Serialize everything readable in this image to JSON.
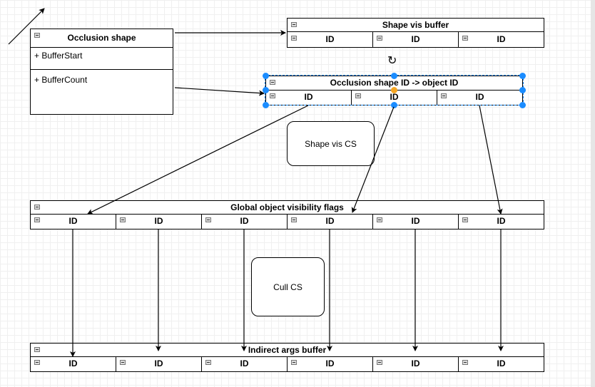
{
  "class_box": {
    "title": "Occlusion shape",
    "attributes": [
      "+ BufferStart",
      "+ BufferCount"
    ]
  },
  "shape_vis_buffer": {
    "title": "Shape vis buffer",
    "cells": [
      "ID",
      "ID",
      "ID"
    ]
  },
  "occlusion_map": {
    "title": "Occlusion shape ID -> object ID",
    "cells": [
      "ID",
      "ID",
      "ID"
    ],
    "selected": true
  },
  "shape_vis_cs": {
    "label": "Shape vis CS"
  },
  "global_flags": {
    "title": "Global object visibility flags",
    "cells": [
      "ID",
      "ID",
      "ID",
      "ID",
      "ID",
      "ID"
    ]
  },
  "cull_cs": {
    "label": "Cull CS"
  },
  "indirect_args": {
    "title": "Indirect args buffer",
    "cells": [
      "ID",
      "ID",
      "ID",
      "ID",
      "ID",
      "ID"
    ]
  },
  "colors": {
    "selection": "#1a8cff",
    "handle_special": "#f5a623"
  }
}
